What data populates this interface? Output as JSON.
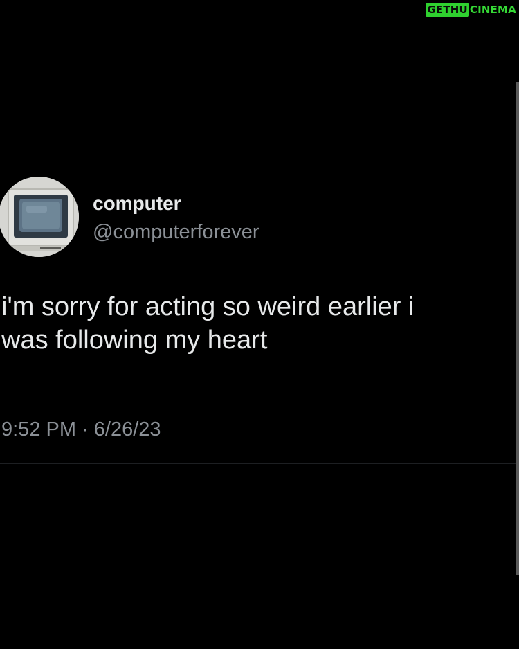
{
  "watermark": {
    "boxed": "GETHU",
    "rest": "CINEMA"
  },
  "tweet": {
    "display_name": "computer",
    "handle": "@computerforever",
    "text_line1": "i'm sorry for acting so weird earlier i",
    "text_line2": "was following my heart",
    "timestamp": "9:52 PM · 6/26/23",
    "avatar_icon": "computer-monitor-icon"
  },
  "colors": {
    "background": "#000000",
    "primary_text": "#e7e9ea",
    "secondary_text": "#8b9096",
    "watermark_green": "#2fd12f"
  }
}
